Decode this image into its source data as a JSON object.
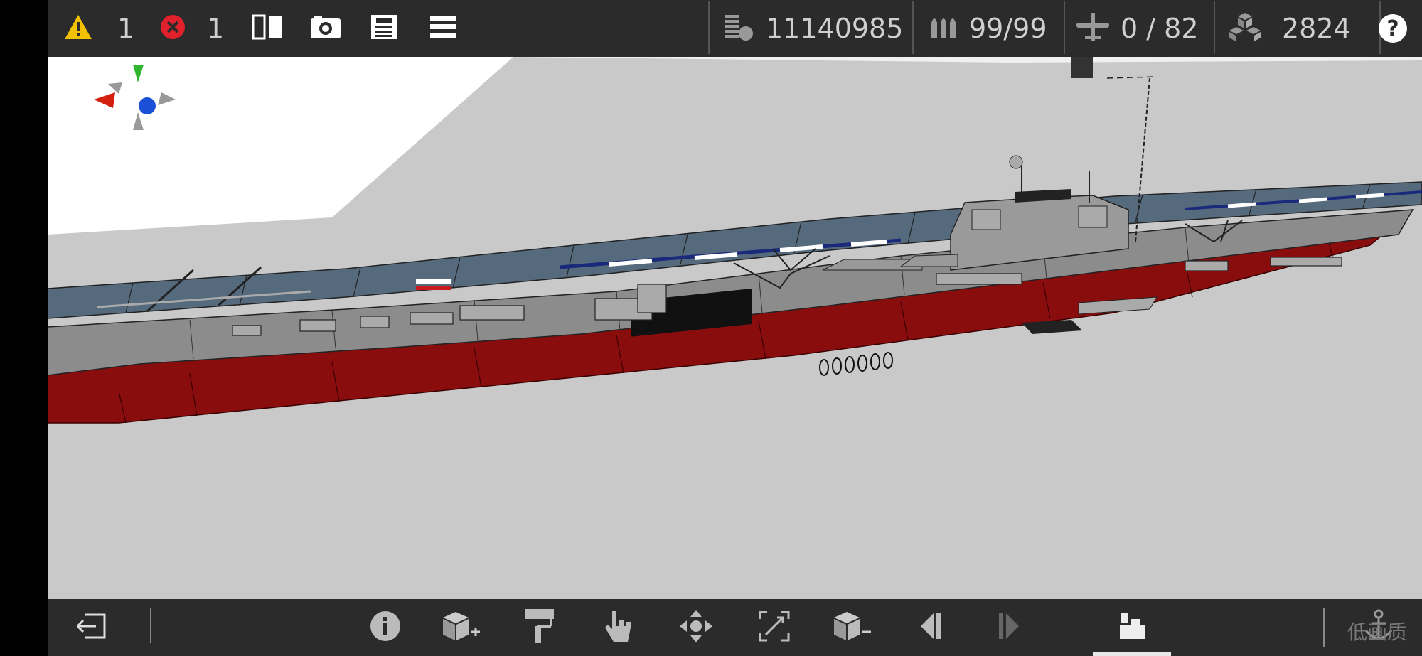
{
  "toolbar": {
    "warnings_count": "1",
    "errors_count": "1",
    "stats": {
      "cost": "11140985",
      "ammo": "99/99",
      "aircraft": "0 / 82",
      "parts": "2824"
    }
  },
  "bottom": {
    "quality_label": "低画质"
  },
  "colors": {
    "bar_bg": "#2b2b2b",
    "viewport_bg": "#c9c9c9",
    "hull_red": "#8a0d0d",
    "deck_blue": "#566a7e",
    "warning_yellow": "#f2c200",
    "error_red": "#e0202a"
  },
  "icons": [
    "warning-icon",
    "error-icon",
    "mirror-icon",
    "camera-icon",
    "save-icon",
    "menu-icon",
    "cost-icon",
    "ammo-icon",
    "aircraft-icon",
    "parts-icon",
    "help-icon",
    "exit-icon",
    "info-icon",
    "add-block-icon",
    "paint-icon",
    "select-icon",
    "move-icon",
    "resize-icon",
    "remove-block-icon",
    "prev-icon",
    "next-icon",
    "mode-icon",
    "anchor-icon"
  ]
}
